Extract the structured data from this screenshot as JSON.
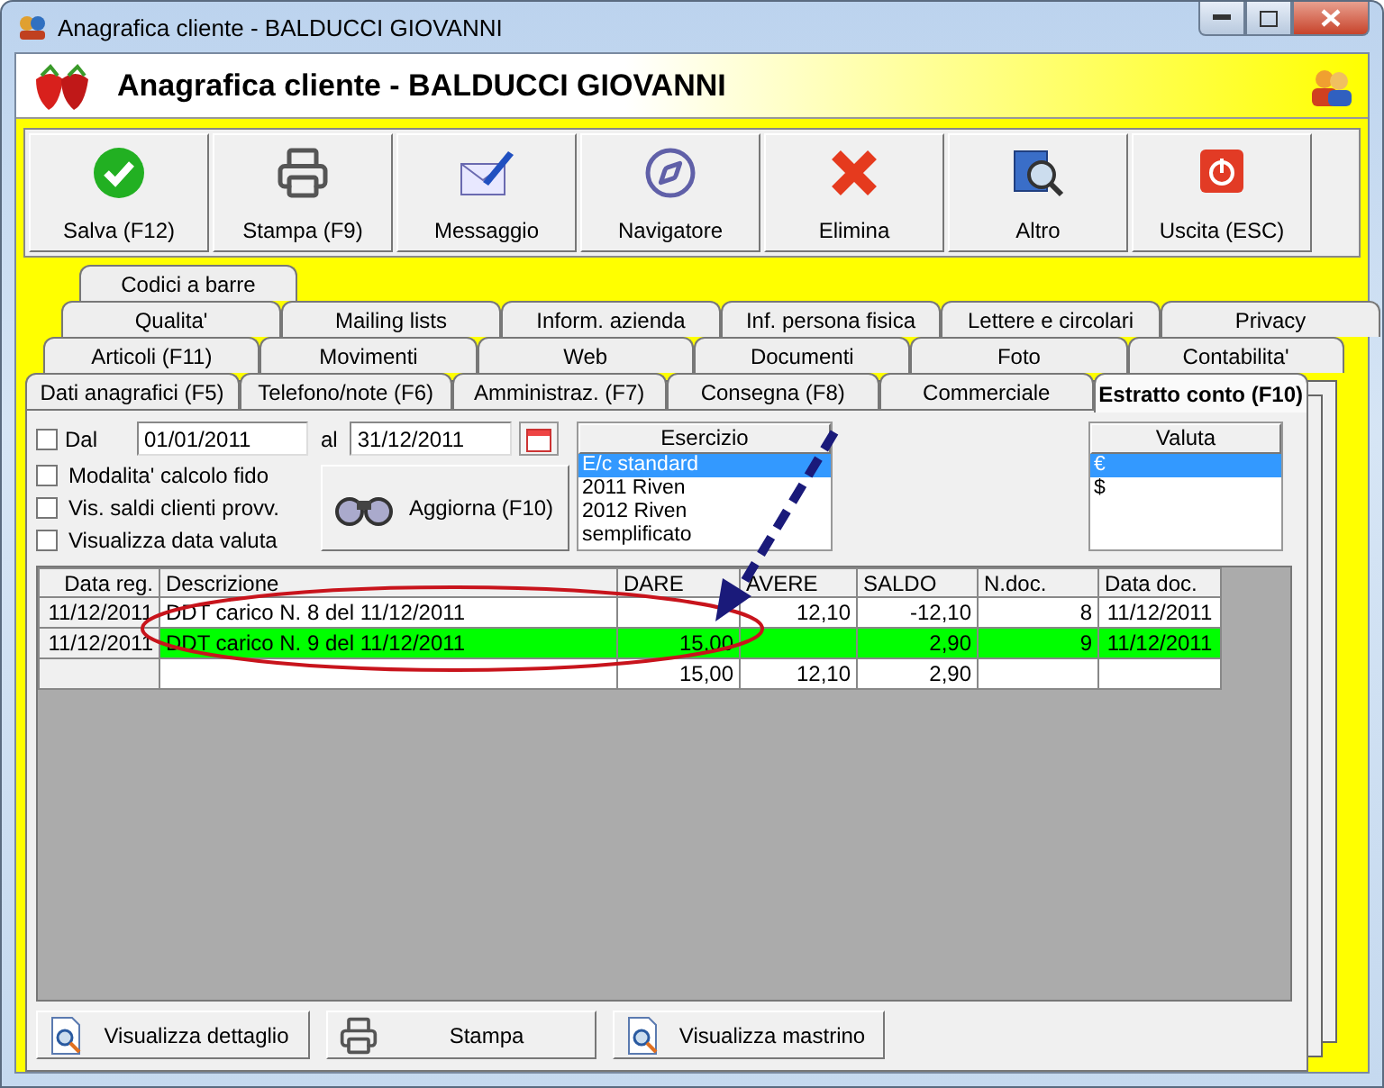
{
  "window": {
    "title": "Anagrafica cliente - BALDUCCI GIOVANNI"
  },
  "header": {
    "title": "Anagrafica cliente - BALDUCCI GIOVANNI"
  },
  "toolbar": [
    {
      "kind": "save",
      "label": "Salva (F12)"
    },
    {
      "kind": "print",
      "label": "Stampa (F9)"
    },
    {
      "kind": "message",
      "label": "Messaggio"
    },
    {
      "kind": "navigator",
      "label": "Navigatore"
    },
    {
      "kind": "delete",
      "label": "Elimina"
    },
    {
      "kind": "other",
      "label": "Altro"
    },
    {
      "kind": "exit",
      "label": "Uscita (ESC)"
    }
  ],
  "tab_rows": [
    [
      {
        "label": "Codici a barre",
        "selected": false
      }
    ],
    [
      {
        "label": "Qualita'",
        "selected": false
      },
      {
        "label": "Mailing lists",
        "selected": false
      },
      {
        "label": "Inform. azienda",
        "selected": false
      },
      {
        "label": "Inf. persona fisica",
        "selected": false
      },
      {
        "label": "Lettere e circolari",
        "selected": false
      },
      {
        "label": "Privacy",
        "selected": false
      }
    ],
    [
      {
        "label": "Articoli (F11)",
        "selected": false
      },
      {
        "label": "Movimenti",
        "selected": false
      },
      {
        "label": "Web",
        "selected": false
      },
      {
        "label": "Documenti",
        "selected": false
      },
      {
        "label": "Foto",
        "selected": false
      },
      {
        "label": "Contabilita'",
        "selected": false
      }
    ],
    [
      {
        "label": "Dati anagrafici (F5)",
        "selected": false
      },
      {
        "label": "Telefono/note (F6)",
        "selected": false
      },
      {
        "label": "Amministraz. (F7)",
        "selected": false
      },
      {
        "label": "Consegna (F8)",
        "selected": false
      },
      {
        "label": "Commerciale",
        "selected": false
      },
      {
        "label": "Estratto conto (F10)",
        "selected": true
      }
    ]
  ],
  "filters": {
    "period": {
      "label": "Dal",
      "checked": false,
      "date_from": "01/01/2011",
      "to_label": "al",
      "date_to": "31/12/2011"
    },
    "options": [
      {
        "label": "Modalita' calcolo fido",
        "checked": false
      },
      {
        "label": "Vis. saldi clienti provv.",
        "checked": false
      },
      {
        "label": "Visualizza data valuta",
        "checked": false
      }
    ],
    "refresh_button": "Aggiorna (F10)"
  },
  "esercizio": {
    "title": "Esercizio",
    "items": [
      {
        "label": "E/c standard",
        "selected": true
      },
      {
        "label": "2011 Riven",
        "selected": false
      },
      {
        "label": "2012 Riven",
        "selected": false
      },
      {
        "label": "semplificato",
        "selected": false
      }
    ]
  },
  "valuta": {
    "title": "Valuta",
    "items": [
      {
        "label": "€",
        "selected": true
      },
      {
        "label": "$",
        "selected": false
      }
    ]
  },
  "table": {
    "columns": [
      "Data reg.",
      "Descrizione",
      "DARE",
      "AVERE",
      "SALDO",
      "N.doc.",
      "Data doc."
    ],
    "rows": [
      {
        "highlighted": false,
        "cells": [
          "11/12/2011",
          "DDT carico N. 8 del 11/12/2011",
          "",
          "12,10",
          "-12,10",
          "8",
          "11/12/2011"
        ]
      },
      {
        "highlighted": true,
        "cells": [
          "11/12/2011",
          "DDT carico N. 9 del 11/12/2011",
          "15,00",
          "",
          "2,90",
          "9",
          "11/12/2011"
        ]
      }
    ],
    "totals": {
      "dare": "15,00",
      "avere": "12,10",
      "saldo": "2,90"
    }
  },
  "bottom_buttons": [
    {
      "kind": "detail",
      "label": "Visualizza dettaglio"
    },
    {
      "kind": "print",
      "label": "Stampa"
    },
    {
      "kind": "ledger",
      "label": "Visualizza mastrino"
    }
  ]
}
